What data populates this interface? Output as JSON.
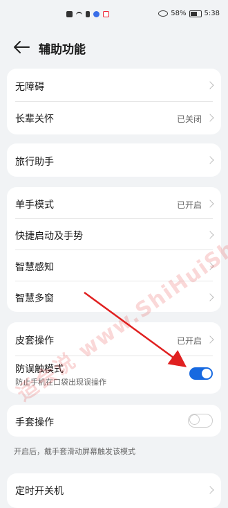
{
  "status": {
    "battery": "58%",
    "time": "5:38"
  },
  "header": {
    "title": "辅助功能"
  },
  "items": {
    "accessibility": "无障碍",
    "elderly_care": {
      "label": "长辈关怀",
      "value": "已关闭"
    },
    "travel_assistant": "旅行助手",
    "one_hand": {
      "label": "单手模式",
      "value": "已开启"
    },
    "quick_start": "快捷启动及手势",
    "smart_sense": "智慧感知",
    "smart_multiwindow": "智慧多窗",
    "cover_operation": {
      "label": "皮套操作",
      "value": "已开启"
    },
    "accidental_touch": {
      "label": "防误触模式",
      "desc": "防止手机在口袋出现误操作",
      "enabled": true
    },
    "glove_operation": {
      "label": "手套操作",
      "enabled": false
    },
    "glove_hint": "开启后，戴手套滑动屏幕触发该模式",
    "scheduled_power": "定时开关机"
  },
  "watermark": "适会说 www.ShiHuiShuo.com",
  "colors": {
    "toggle_on": "#1769e0",
    "arrow": "#e02020"
  }
}
